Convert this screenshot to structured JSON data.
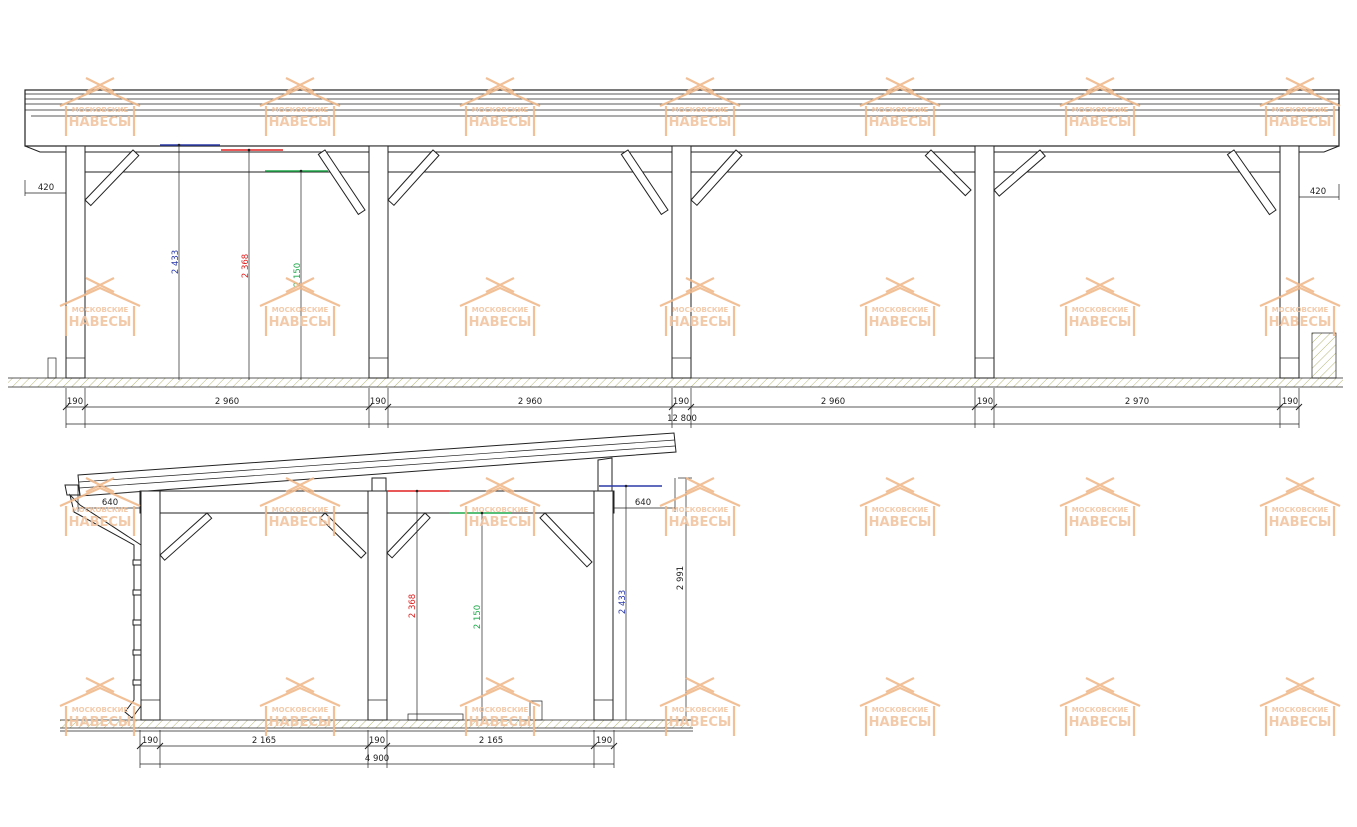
{
  "watermark": {
    "line1": "МОСКОВСКИЕ",
    "line2": "НАВЕСЫ"
  },
  "front_view": {
    "overhang_left": "420",
    "overhang_right": "420",
    "post_widths": [
      "190",
      "190",
      "190",
      "190",
      "190"
    ],
    "bays": [
      "2 960",
      "2 960",
      "2 960",
      "2 970"
    ],
    "total": "12 800",
    "heights": [
      {
        "label": "2 433",
        "color": "#2b3aa8"
      },
      {
        "label": "2 368",
        "color": "#e02020"
      },
      {
        "label": "2 150",
        "color": "#1fa84a"
      }
    ]
  },
  "side_view": {
    "overhang_left": "640",
    "overhang_right": "640",
    "post_widths": [
      "190",
      "190",
      "190"
    ],
    "bays": [
      "2 165",
      "2 165"
    ],
    "total": "4 900",
    "overall_height": "2 991",
    "heights": [
      {
        "label": "2 368",
        "color": "#e02020"
      },
      {
        "label": "2 150",
        "color": "#1fa84a"
      },
      {
        "label": "2 433",
        "color": "#2b3aa8"
      }
    ]
  },
  "colors": {
    "line": "#222222",
    "ground_hatch": "#b5b87a",
    "watermark": "#f0b98c",
    "blue": "#2b3aa8",
    "red": "#e02020",
    "green": "#1fa84a"
  }
}
